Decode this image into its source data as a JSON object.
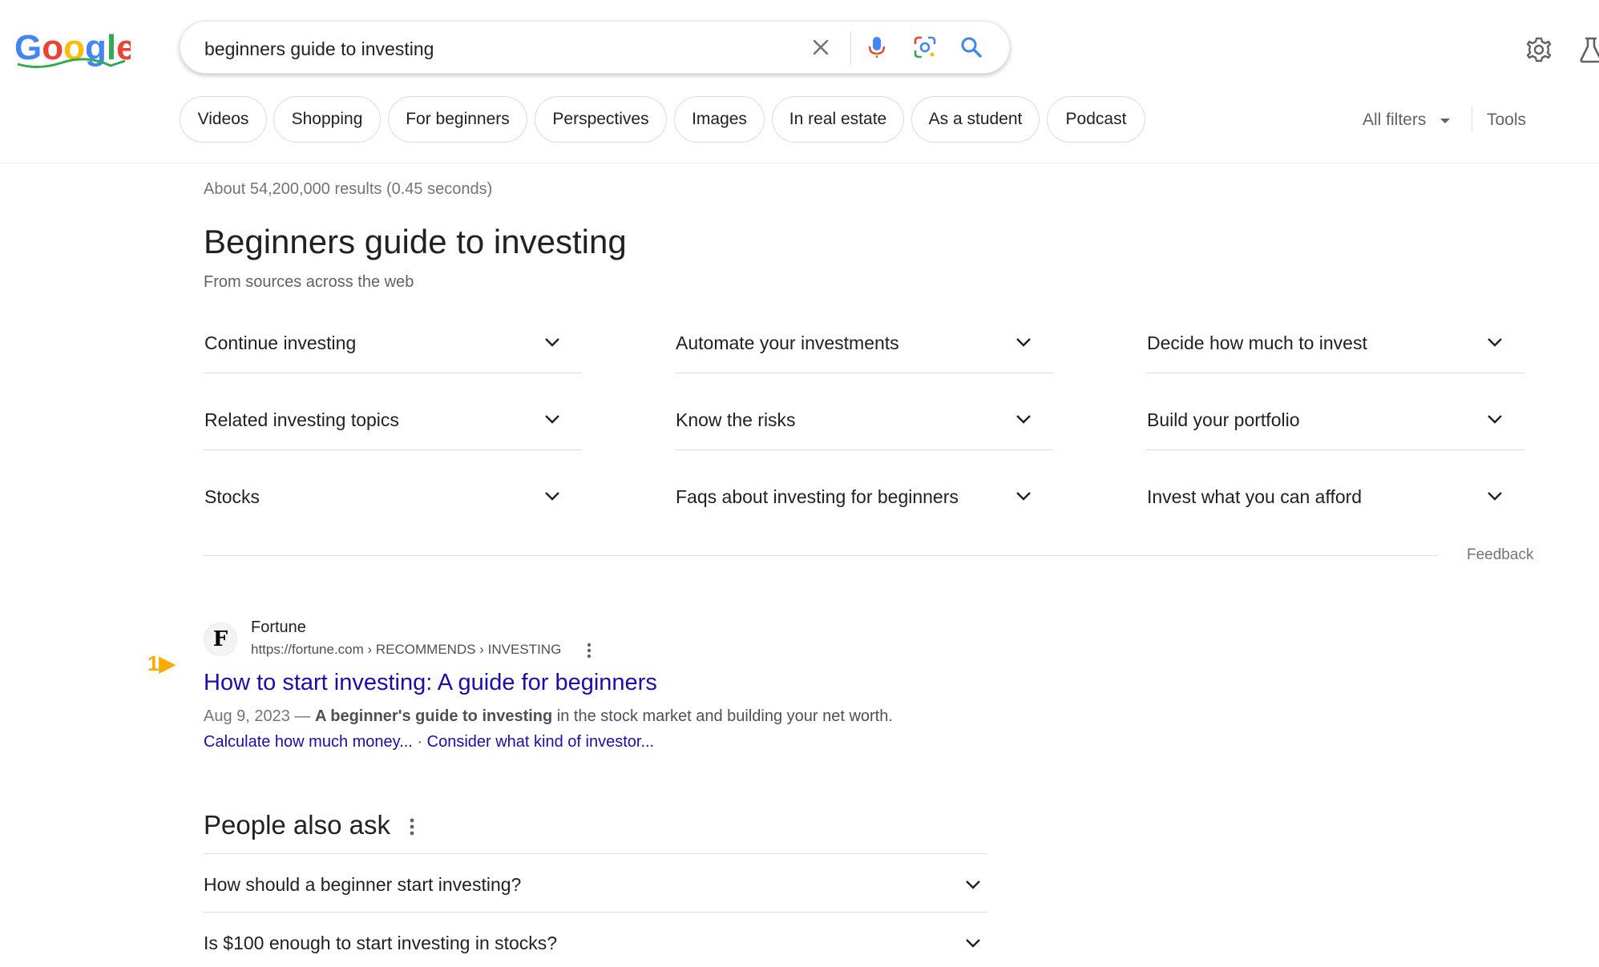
{
  "search": {
    "query": "beginners guide to investing"
  },
  "chips": [
    "Videos",
    "Shopping",
    "For beginners",
    "Perspectives",
    "Images",
    "In real estate",
    "As a student",
    "Podcast"
  ],
  "filters": {
    "all_filters": "All filters",
    "tools": "Tools"
  },
  "results_stats": "About 54,200,000 results (0.45 seconds)",
  "guide": {
    "title": "Beginners guide to investing",
    "subtitle": "From sources across the web",
    "topics": [
      "Continue investing",
      "Automate your investments",
      "Decide how much to invest",
      "Related investing topics",
      "Know the risks",
      "Build your portfolio",
      "Stocks",
      "Faqs about investing for beginners",
      "Invest what you can afford"
    ],
    "feedback": "Feedback"
  },
  "result": {
    "rank_marker": "1▶",
    "logo_letter": "F",
    "site_name": "Fortune",
    "url": "https://fortune.com › RECOMMENDS › INVESTING",
    "title": "How to start investing: A guide for beginners",
    "date": "Aug 9, 2023 — ",
    "snippet_bold": "A beginner's guide to investing",
    "snippet_rest": " in the stock market and building your net worth.",
    "sitelink_1": "Calculate how much money...",
    "sitelink_sep": " · ",
    "sitelink_2": "Consider what kind of investor..."
  },
  "people_also_ask": {
    "title": "People also ask",
    "questions": [
      "How should a beginner start investing?",
      "Is $100 enough to start investing in stocks?"
    ]
  },
  "colors": {
    "link": "#1a0dab",
    "accent_blue": "#4285f4",
    "marker": "#f9ab00"
  }
}
